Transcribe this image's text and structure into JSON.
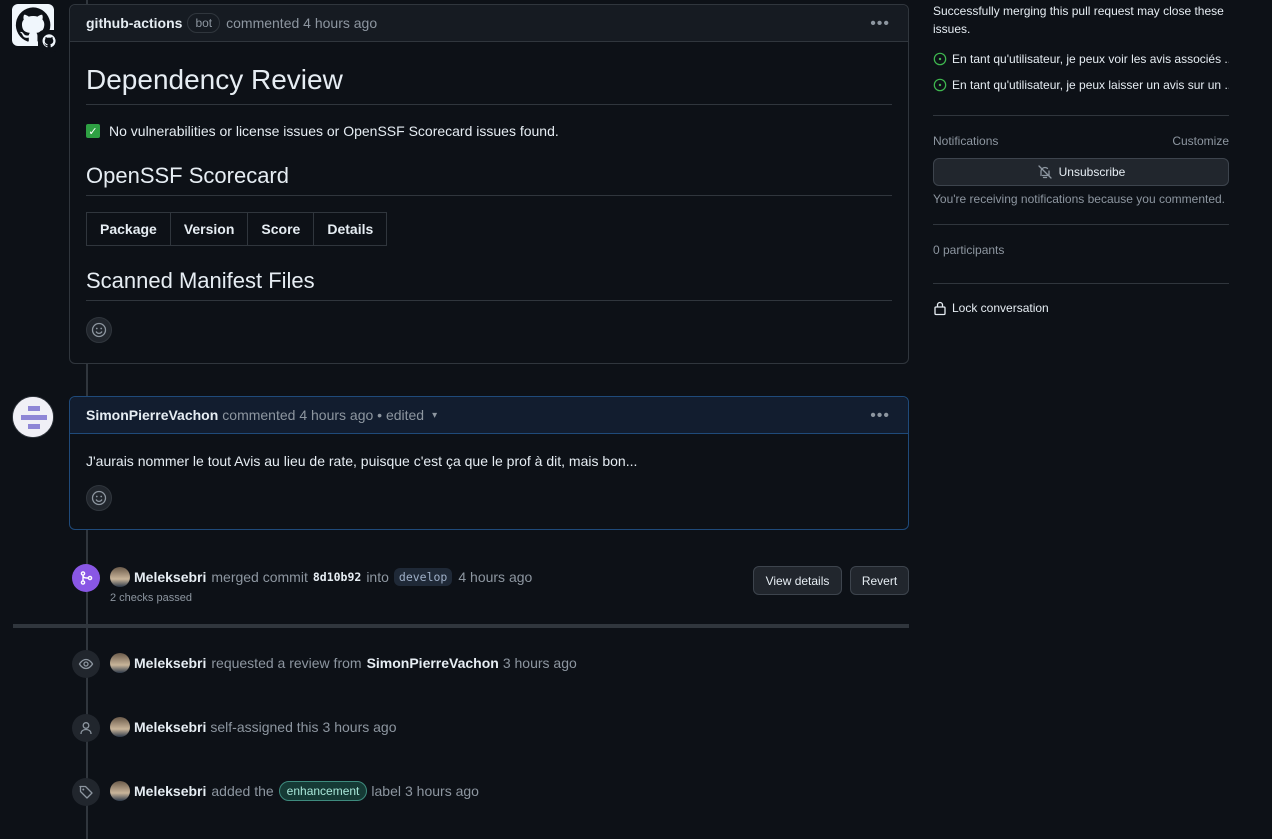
{
  "comment1": {
    "author": "github-actions",
    "bot_tag": "bot",
    "meta": "commented 4 hours ago",
    "h1": "Dependency Review",
    "check_emoji": "✅",
    "summary": "No vulnerabilities or license issues or OpenSSF Scorecard issues found.",
    "h2_scorecard": "OpenSSF Scorecard",
    "table_headers": [
      "Package",
      "Version",
      "Score",
      "Details"
    ],
    "h2_manifest": "Scanned Manifest Files"
  },
  "comment2": {
    "author": "SimonPierreVachon",
    "meta": "commented 4 hours ago • edited",
    "body": "J'aurais nommer le tout Avis au lieu de rate, puisque c'est ça que le prof à dit, mais bon..."
  },
  "merge_event": {
    "actor": "Meleksebri",
    "verb": "merged commit",
    "sha": "8d10b92",
    "into": "into",
    "branch": "develop",
    "time": "4 hours ago",
    "checks": "2 checks passed",
    "view_details": "View details",
    "revert": "Revert"
  },
  "events": [
    {
      "actor": "Meleksebri",
      "text": "requested a review from",
      "target": "SimonPierreVachon",
      "time": "3 hours ago"
    },
    {
      "actor": "Meleksebri",
      "text": "self-assigned this",
      "time": "3 hours ago"
    },
    {
      "actor": "Meleksebri",
      "text": "added the",
      "label": "enhancement",
      "after": "label",
      "time": "3 hours ago"
    }
  ],
  "sidebar": {
    "closing_text": "Successfully merging this pull request may close these issues.",
    "issues": [
      "En tant qu'utilisateur, je peux voir les avis associés ...",
      "En tant qu'utilisateur, je peux laisser un avis sur un ..."
    ],
    "notifications_label": "Notifications",
    "customize": "Customize",
    "unsubscribe": "Unsubscribe",
    "notif_reason": "You're receiving notifications because you commented.",
    "participants": "0 participants",
    "lock": "Lock conversation"
  },
  "colors": {
    "accent_merge": "#8957e5",
    "open_issue": "#3fb950",
    "label": "#3e8b7e"
  }
}
